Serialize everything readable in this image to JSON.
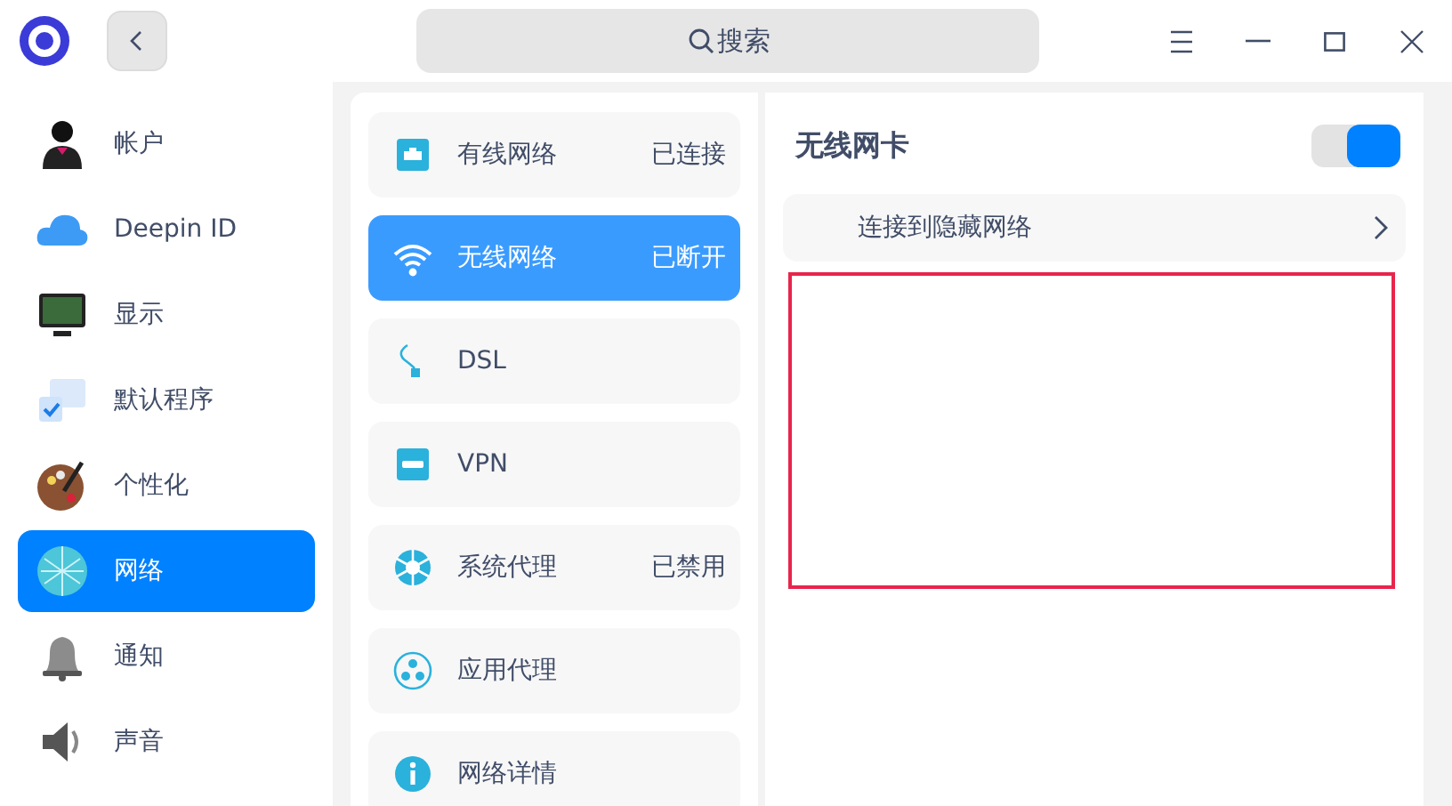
{
  "titlebar": {
    "search": {
      "placeholder": "搜索"
    }
  },
  "sidebar": {
    "items": [
      {
        "label": "帐户",
        "selected": false
      },
      {
        "label": "Deepin ID",
        "selected": false
      },
      {
        "label": "显示",
        "selected": false
      },
      {
        "label": "默认程序",
        "selected": false
      },
      {
        "label": "个性化",
        "selected": false
      },
      {
        "label": "网络",
        "selected": true
      },
      {
        "label": "通知",
        "selected": false
      },
      {
        "label": "声音",
        "selected": false
      }
    ]
  },
  "network_list": {
    "items": [
      {
        "label": "有线网络",
        "status": "已连接",
        "selected": false
      },
      {
        "label": "无线网络",
        "status": "已断开",
        "selected": true
      },
      {
        "label": "DSL",
        "selected": false
      },
      {
        "label": "VPN",
        "selected": false
      },
      {
        "label": "系统代理",
        "status": "已禁用",
        "selected": false
      },
      {
        "label": "应用代理",
        "selected": false
      },
      {
        "label": "网络详情",
        "selected": false
      }
    ]
  },
  "wireless_card": {
    "title": "无线网卡",
    "on": true,
    "hidden_network_link": "连接到隐藏网络"
  }
}
